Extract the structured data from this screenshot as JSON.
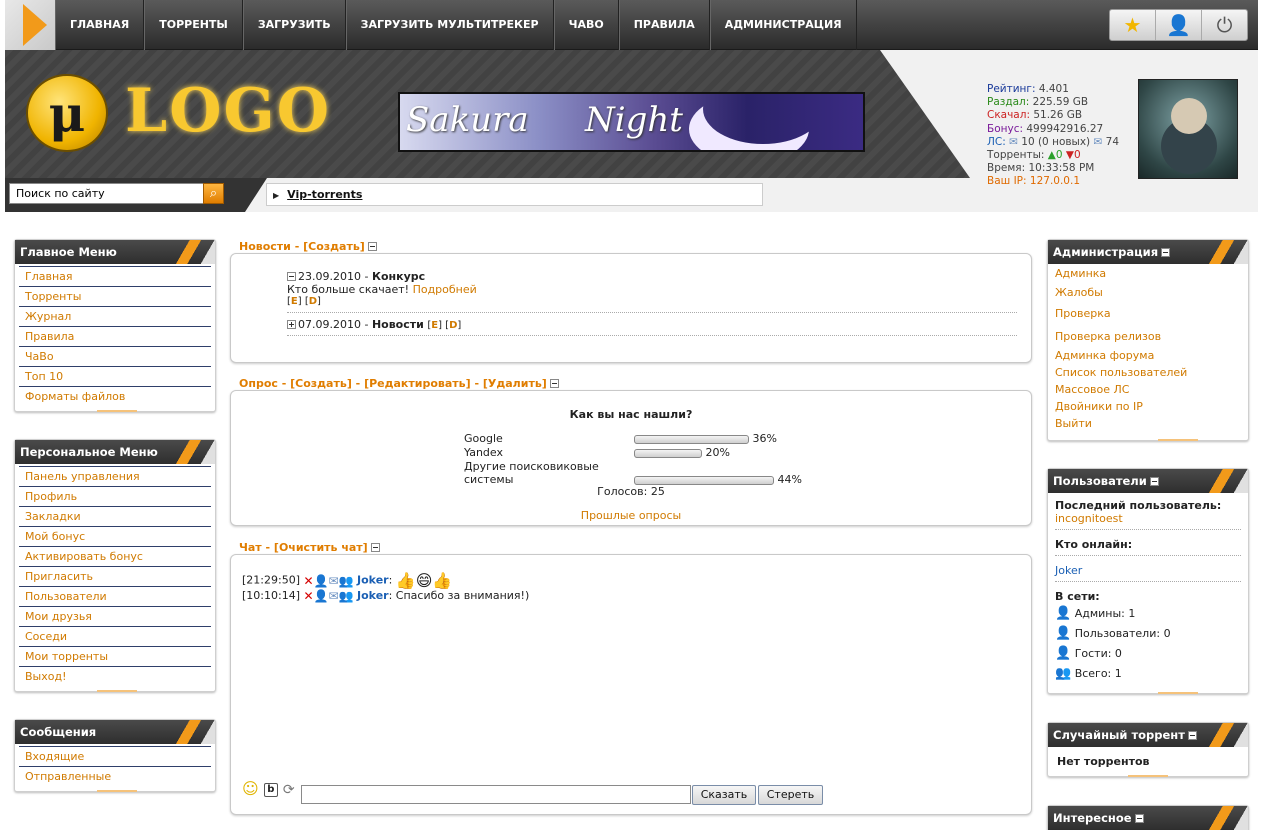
{
  "nav": {
    "items": [
      "ГЛАВНАЯ",
      "ТОРРЕНТЫ",
      "ЗАГРУЗИТЬ",
      "ЗАГРУЗИТЬ МУЛЬТИТРЕКЕР",
      "ЧАВО",
      "ПРАВИЛА",
      "АДМИНИСТРАЦИЯ"
    ],
    "icons": [
      "star-add-icon",
      "user-icon",
      "power-icon"
    ]
  },
  "header": {
    "logo_symbol": "μ",
    "logo_text": "LOGO",
    "banner_word1": "Sakura",
    "banner_word2": "Night",
    "search_placeholder": "Поиск по сайту",
    "vip_link": "Vip-torrents"
  },
  "userinfo": {
    "rating_label": "Рейтинг:",
    "rating": "4.401",
    "upload_label": "Раздал:",
    "upload": "225.59 GB",
    "download_label": "Скачал:",
    "download": "51.26 GB",
    "bonus_label": "Бонус:",
    "bonus": "499942916.27",
    "pm_label": "ЛС:",
    "pm": "10 (0 новых)",
    "pm_out": "74",
    "torrents_label": "Торренты:",
    "seeding": "0",
    "leeching": "0",
    "time_label": "Время:",
    "time": "10:33:58 PM",
    "ip_label": "Ваш IP:",
    "ip": "127.0.0.1",
    "colors": {
      "rating": "#1a3a9a",
      "upload": "#2a8a1a",
      "download": "#cc2222",
      "bonus": "#7a1a9a",
      "ip": "#e06a00"
    }
  },
  "left": {
    "main_menu": {
      "title": "Главное Меню",
      "items": [
        "Главная",
        "Торренты",
        "Журнал",
        "Правила",
        "ЧаВо",
        "Топ 10",
        "Форматы файлов"
      ]
    },
    "personal_menu": {
      "title": "Персональное Меню",
      "items": [
        "Панель управления",
        "Профиль",
        "Закладки",
        "Мой бонус",
        "Активировать бонус",
        "Пригласить",
        "Пользователи",
        "Мои друзья",
        "Соседи",
        "Мои торренты",
        "Выход!"
      ]
    },
    "messages": {
      "title": "Сообщения",
      "items": [
        "Входящие",
        "Отправленные"
      ]
    }
  },
  "news": {
    "title": "Новости - [Создать]",
    "items": [
      {
        "date": "23.09.2010",
        "sep": " - ",
        "title": "Конкурс",
        "text": "Кто больше скачает!",
        "more": "Подробней"
      },
      {
        "date": "07.09.2010",
        "sep": " - ",
        "title": "Новости"
      }
    ],
    "edit": "E",
    "del": "D"
  },
  "poll": {
    "title": "Опрос - [Создать] - [Редактировать] - [Удалить]",
    "question": "Как вы нас нашли?",
    "options": [
      {
        "label": "Google",
        "percent": 36,
        "text": "36%"
      },
      {
        "label": "Yandex",
        "percent": 20,
        "text": "20%"
      },
      {
        "label": "Другие поисковиковые системы",
        "percent": 44,
        "text": "44%"
      }
    ],
    "votes": "Голосов: 25",
    "past": "Прошлые опросы"
  },
  "chat": {
    "title": "Чат - [Очистить чат]",
    "messages": [
      {
        "time": "[21:29:50]",
        "user": "Joker",
        "text": ""
      },
      {
        "time": "[10:10:14]",
        "user": "Joker",
        "text": " Спасибо за внимания!)"
      }
    ],
    "say_label": "Сказать",
    "clear_label": "Стереть"
  },
  "right": {
    "admin": {
      "title": "Администрация",
      "items": [
        "Админка",
        "Жалобы",
        "Проверка",
        "Проверка релизов",
        "Админка форума",
        "Список пользователей",
        "Массовое ЛС",
        "Двойники по IP",
        "Выйти"
      ]
    },
    "users": {
      "title": "Пользователи",
      "last_label": "Последний пользователь:",
      "last_user": "incognitoest",
      "online_label": "Кто онлайн:",
      "online_user": "Joker",
      "net_label": "В сети:",
      "admins": "Админы: 1",
      "users": "Пользователи: 0",
      "guests": "Гости: 0",
      "total": "Всего: 1"
    },
    "random": {
      "title": "Случайный торрент",
      "text": "Нет торрентов"
    },
    "interesting": {
      "title": "Интересное"
    }
  }
}
